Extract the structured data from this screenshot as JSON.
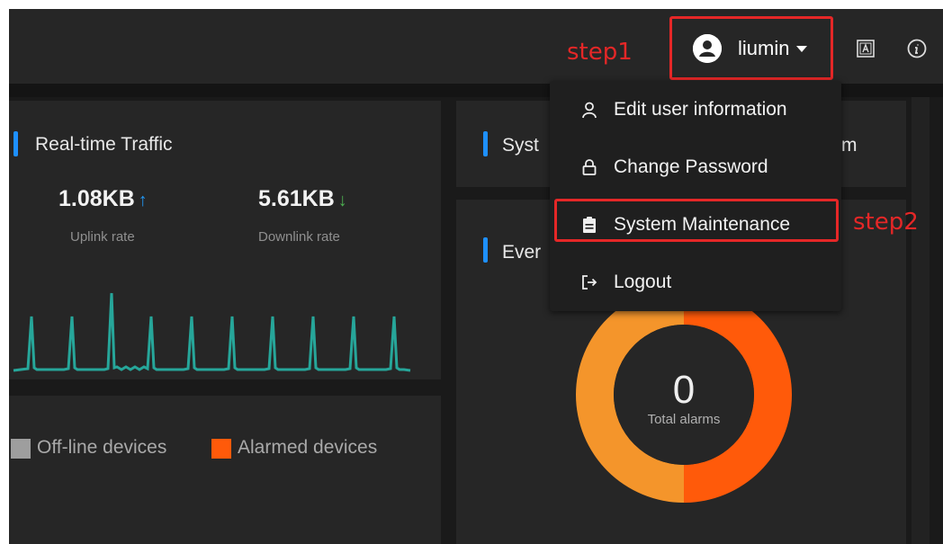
{
  "header": {
    "username": "liumin",
    "step1_label": "step1",
    "step2_label": "step2",
    "icons": [
      "user-avatar-icon",
      "caret-down-icon",
      "language-icon",
      "info-icon"
    ]
  },
  "user_menu": {
    "items": [
      {
        "label": "Edit user information",
        "icon": "user-icon"
      },
      {
        "label": "Change Password",
        "icon": "lock-icon"
      },
      {
        "label": "System Maintenance",
        "icon": "clipboard-icon"
      },
      {
        "label": "Logout",
        "icon": "logout-icon"
      }
    ]
  },
  "traffic_panel": {
    "title": "Real-time Traffic",
    "uplink": {
      "value": "1.08KB",
      "arrow": "↑",
      "label": "Uplink rate"
    },
    "downlink": {
      "value": "5.61KB",
      "arrow": "↓",
      "label": "Downlink rate"
    },
    "line_color": "#26a69a"
  },
  "system_panel": {
    "title_visible_left": "Syst",
    "title_visible_right": "m"
  },
  "events_panel": {
    "title_visible": "Ever",
    "total_value": "0",
    "total_label": "Total alarms",
    "colors": {
      "left_half": "#f4952b",
      "right_half": "#ff5a0a"
    }
  },
  "legend": {
    "items": [
      {
        "label": "Off-line devices",
        "color": "#9e9e9e"
      },
      {
        "label": "Alarmed devices",
        "color": "#ff5a0a"
      }
    ]
  },
  "colors": {
    "accent": "#1e90ff",
    "annotation": "#e52727",
    "panel": "#262626",
    "background": "#1a1a1a"
  }
}
